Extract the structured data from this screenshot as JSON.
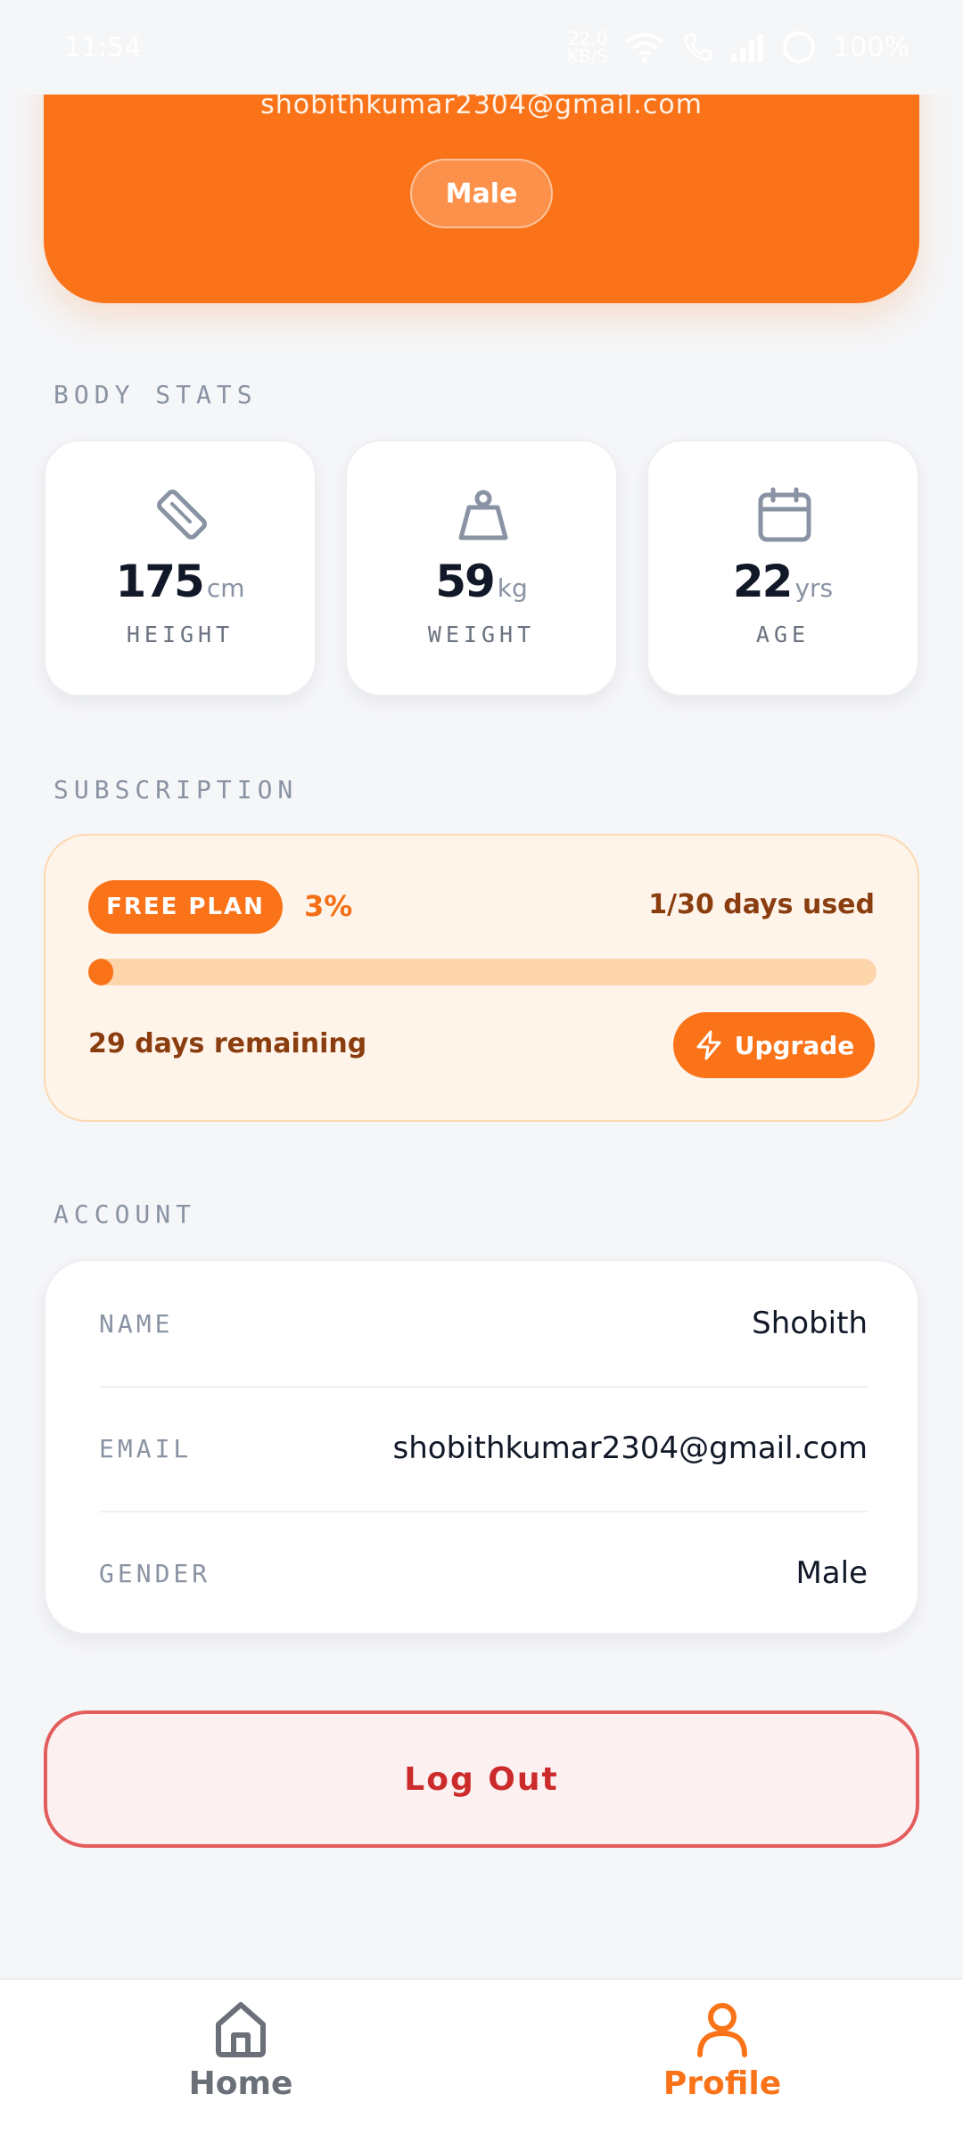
{
  "status_bar": {
    "time": "11:54",
    "net_speed_value": "22.0",
    "net_speed_unit": "KB/S",
    "battery": "100%"
  },
  "profile_header": {
    "email": "shobithkumar2304@gmail.com",
    "gender": "Male"
  },
  "body_stats": {
    "title": "BODY STATS",
    "items": [
      {
        "label": "HEIGHT",
        "value": "175",
        "unit": "cm",
        "icon": "ruler-icon"
      },
      {
        "label": "WEIGHT",
        "value": "59",
        "unit": "kg",
        "icon": "weight-icon"
      },
      {
        "label": "AGE",
        "value": "22",
        "unit": "yrs",
        "icon": "calendar-icon"
      }
    ]
  },
  "subscription": {
    "title": "SUBSCRIPTION",
    "plan": "FREE PLAN",
    "percent_text": "3%",
    "progress_fraction": 0.03,
    "days_used": "1/30 days used",
    "remaining": "29 days remaining",
    "upgrade_label": "Upgrade"
  },
  "account": {
    "title": "ACCOUNT",
    "rows": [
      {
        "key": "NAME",
        "value": "Shobith"
      },
      {
        "key": "EMAIL",
        "value": "shobithkumar2304@gmail.com"
      },
      {
        "key": "GENDER",
        "value": "Male"
      }
    ]
  },
  "logout_label": "Log Out",
  "nav": {
    "home": "Home",
    "profile": "Profile"
  },
  "colors": {
    "accent": "#fa7319",
    "muted": "#8a93a3",
    "danger": "#e35d5d",
    "inactive": "#6b6f78"
  }
}
